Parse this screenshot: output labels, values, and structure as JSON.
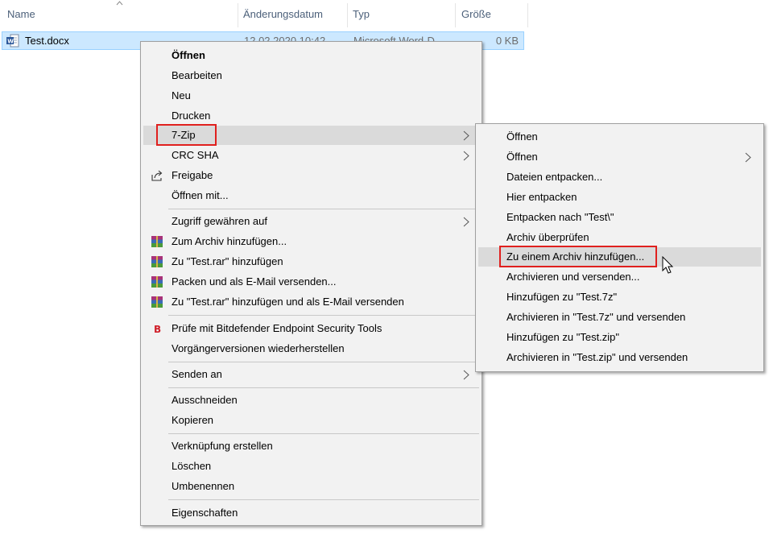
{
  "columns": {
    "name": "Name",
    "date": "Änderungsdatum",
    "type": "Typ",
    "size": "Größe"
  },
  "file": {
    "name": "Test.docx",
    "date": "12.02.2020 10:42",
    "type": "Microsoft Word-D...",
    "size": "0 KB"
  },
  "context_menu": {
    "open": "Öffnen",
    "edit": "Bearbeiten",
    "new": "Neu",
    "print": "Drucken",
    "seven_zip": "7-Zip",
    "crc_sha": "CRC SHA",
    "share": "Freigabe",
    "open_with": "Öffnen mit...",
    "grant_access": "Zugriff gewähren auf",
    "add_archive": "Zum Archiv hinzufügen...",
    "add_rar": "Zu \"Test.rar\" hinzufügen",
    "pack_email": "Packen und als E-Mail versenden...",
    "add_rar_email": "Zu \"Test.rar\" hinzufügen und als E-Mail versenden",
    "bitdefender": "Prüfe mit Bitdefender Endpoint Security Tools",
    "restore_versions": "Vorgängerversionen wiederherstellen",
    "send_to": "Senden an",
    "cut": "Ausschneiden",
    "copy": "Kopieren",
    "create_shortcut": "Verknüpfung erstellen",
    "delete": "Löschen",
    "rename": "Umbenennen",
    "properties": "Eigenschaften"
  },
  "sevenzip_menu": {
    "open": "Öffnen",
    "open_sub": "Öffnen",
    "extract_files": "Dateien entpacken...",
    "extract_here": "Hier entpacken",
    "extract_to": "Entpacken nach \"Test\\\"",
    "test_archive": "Archiv überprüfen",
    "add_to_archive": "Zu einem Archiv hinzufügen...",
    "archive_send": "Archivieren und versenden...",
    "add_7z": "Hinzufügen zu \"Test.7z\"",
    "archive_7z_send": "Archivieren in \"Test.7z\" und versenden",
    "add_zip": "Hinzufügen zu \"Test.zip\"",
    "archive_zip_send": "Archivieren in \"Test.zip\" und versenden"
  },
  "colors": {
    "highlight": "#e0201e",
    "selection": "#cce8ff",
    "menu_bg": "#f2f2f2",
    "hover": "#dadada"
  }
}
